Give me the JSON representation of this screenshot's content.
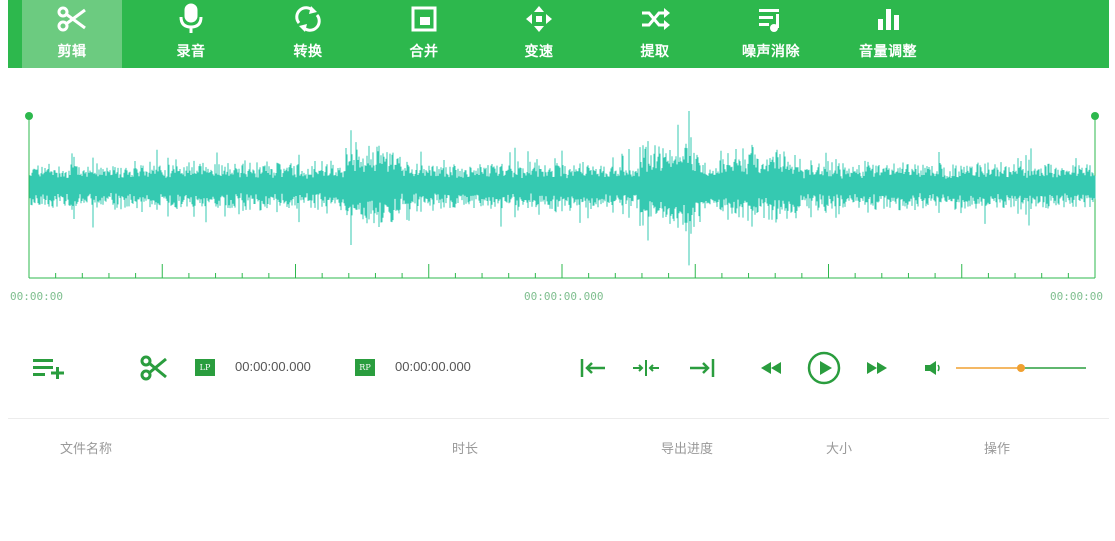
{
  "colors": {
    "toolbar_bg": "#2db84d",
    "active_tab_bg": "#6ccb80",
    "waveform": "#35c9b1",
    "accent_green": "#2a9d3e",
    "volume_orange": "#f0a030"
  },
  "toolbar": {
    "items": [
      {
        "label": "剪辑",
        "icon": "scissors-icon",
        "active": true
      },
      {
        "label": "录音",
        "icon": "microphone-icon"
      },
      {
        "label": "转换",
        "icon": "convert-icon"
      },
      {
        "label": "合并",
        "icon": "merge-icon"
      },
      {
        "label": "变速",
        "icon": "speed-icon"
      },
      {
        "label": "提取",
        "icon": "shuffle-icon"
      },
      {
        "label": "噪声消除",
        "icon": "noise-icon"
      },
      {
        "label": "音量调整",
        "icon": "volume-bars-icon"
      }
    ]
  },
  "waveform": {
    "start_time": "00:00:00",
    "mid_time": "00:00:00.000",
    "end_time": "00:00:00"
  },
  "controls": {
    "lp_tag": "LP",
    "lp_time": "00:00:00.000",
    "rp_tag": "RP",
    "rp_time": "00:00:00.000",
    "volume_level": 0.5
  },
  "file_table": {
    "columns": [
      "文件名称",
      "时长",
      "导出进度",
      "大小",
      "操作"
    ]
  }
}
